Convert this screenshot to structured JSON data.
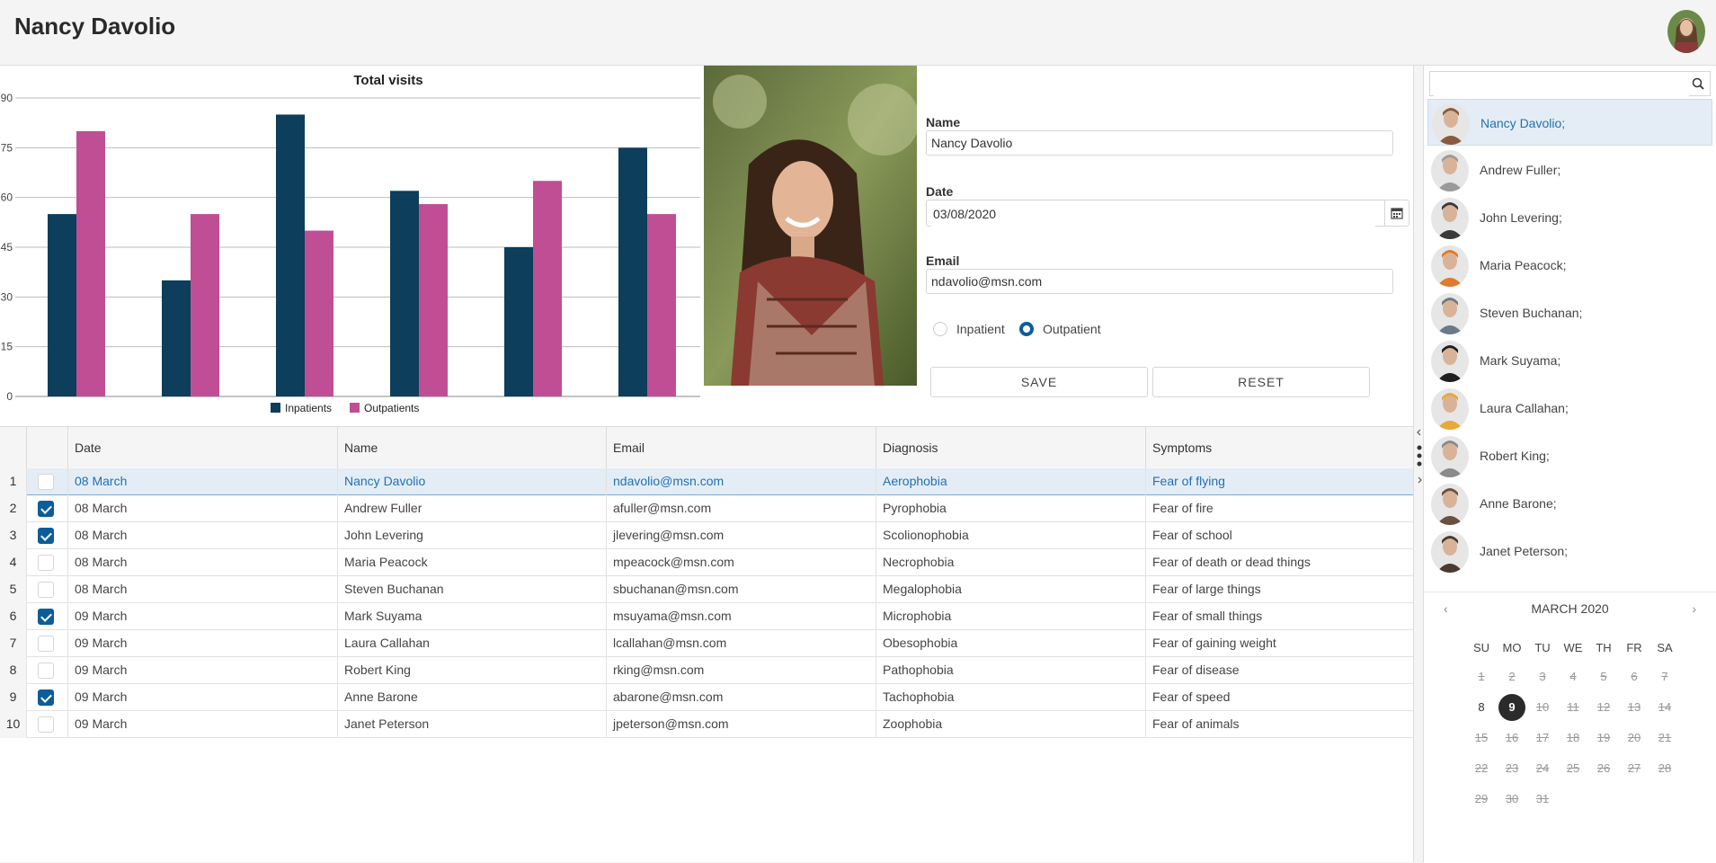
{
  "header": {
    "title": "Nancy Davolio"
  },
  "chart_data": {
    "type": "bar",
    "title": "Total visits",
    "categories": [
      "",
      "",
      "",
      "",
      "",
      ""
    ],
    "series": [
      {
        "name": "Inpatients",
        "values": [
          55,
          35,
          85,
          62,
          45,
          75
        ],
        "color": "#0d3e5c"
      },
      {
        "name": "Outpatients",
        "values": [
          80,
          55,
          50,
          58,
          65,
          55
        ],
        "color": "#c04e95"
      }
    ],
    "ylim": [
      0,
      90
    ],
    "yticks": [
      "0",
      "15",
      "30",
      "45",
      "60",
      "75",
      "90"
    ],
    "legend": "bottom-center",
    "grid": true
  },
  "form": {
    "name_label": "Name",
    "name_value": "Nancy Davolio",
    "date_label": "Date",
    "date_value": "03/08/2020",
    "email_label": "Email",
    "email_value": "ndavolio@msn.com",
    "radio_inpatient": "Inpatient",
    "radio_outpatient": "Outpatient",
    "selected_radio": "Outpatient",
    "save_label": "SAVE",
    "reset_label": "RESET"
  },
  "grid": {
    "columns": [
      "Date",
      "Name",
      "Email",
      "Diagnosis",
      "Symptoms"
    ],
    "rows": [
      {
        "num": "1",
        "checked": false,
        "date": "08 March",
        "name": "Nancy Davolio",
        "email": "ndavolio@msn.com",
        "diagnosis": "Aerophobia",
        "symptoms": "Fear of flying"
      },
      {
        "num": "2",
        "checked": true,
        "date": "08 March",
        "name": "Andrew Fuller",
        "email": "afuller@msn.com",
        "diagnosis": "Pyrophobia",
        "symptoms": "Fear of fire"
      },
      {
        "num": "3",
        "checked": true,
        "date": "08 March",
        "name": "John Levering",
        "email": "jlevering@msn.com",
        "diagnosis": "Scolionophobia",
        "symptoms": "Fear of school"
      },
      {
        "num": "4",
        "checked": false,
        "date": "08 March",
        "name": "Maria Peacock",
        "email": "mpeacock@msn.com",
        "diagnosis": "Necrophobia",
        "symptoms": "Fear of death or dead things"
      },
      {
        "num": "5",
        "checked": false,
        "date": "08 March",
        "name": "Steven Buchanan",
        "email": "sbuchanan@msn.com",
        "diagnosis": "Megalophobia",
        "symptoms": "Fear of large things"
      },
      {
        "num": "6",
        "checked": true,
        "date": "09 March",
        "name": "Mark Suyama",
        "email": "msuyama@msn.com",
        "diagnosis": "Microphobia",
        "symptoms": "Fear of small things"
      },
      {
        "num": "7",
        "checked": false,
        "date": "09 March",
        "name": "Laura Callahan",
        "email": "lcallahan@msn.com",
        "diagnosis": "Obesophobia",
        "symptoms": "Fear of gaining weight"
      },
      {
        "num": "8",
        "checked": false,
        "date": "09 March",
        "name": "Robert King",
        "email": "rking@msn.com",
        "diagnosis": "Pathophobia",
        "symptoms": "Fear of disease"
      },
      {
        "num": "9",
        "checked": true,
        "date": "09 March",
        "name": "Anne Barone",
        "email": "abarone@msn.com",
        "diagnosis": "Tachophobia",
        "symptoms": "Fear of speed"
      },
      {
        "num": "10",
        "checked": false,
        "date": "09 March",
        "name": "Janet Peterson",
        "email": "jpeterson@msn.com",
        "diagnosis": "Zoophobia",
        "symptoms": "Fear of animals"
      }
    ]
  },
  "people": [
    {
      "name": "Nancy Davolio;",
      "color": "#8b5a3c"
    },
    {
      "name": "Andrew Fuller;",
      "color": "#9a9a9a"
    },
    {
      "name": "John Levering;",
      "color": "#3a3a3a"
    },
    {
      "name": "Maria Peacock;",
      "color": "#e07a2c"
    },
    {
      "name": "Steven Buchanan;",
      "color": "#6a7a8a"
    },
    {
      "name": "Mark Suyama;",
      "color": "#1f1f1f"
    },
    {
      "name": "Laura Callahan;",
      "color": "#e8a83a"
    },
    {
      "name": "Robert King;",
      "color": "#8a8a8a"
    },
    {
      "name": "Anne Barone;",
      "color": "#6a5040"
    },
    {
      "name": "Janet Peterson;",
      "color": "#4a3a30"
    }
  ],
  "calendar": {
    "title": "MARCH 2020",
    "dow": [
      "SU",
      "MO",
      "TU",
      "WE",
      "TH",
      "FR",
      "SA"
    ],
    "days": [
      "1",
      "2",
      "3",
      "4",
      "5",
      "6",
      "7",
      "8",
      "9",
      "10",
      "11",
      "12",
      "13",
      "14",
      "15",
      "16",
      "17",
      "18",
      "19",
      "20",
      "21",
      "22",
      "23",
      "24",
      "25",
      "26",
      "27",
      "28",
      "29",
      "30",
      "31"
    ],
    "active_days": [
      "8"
    ],
    "today": "9"
  }
}
